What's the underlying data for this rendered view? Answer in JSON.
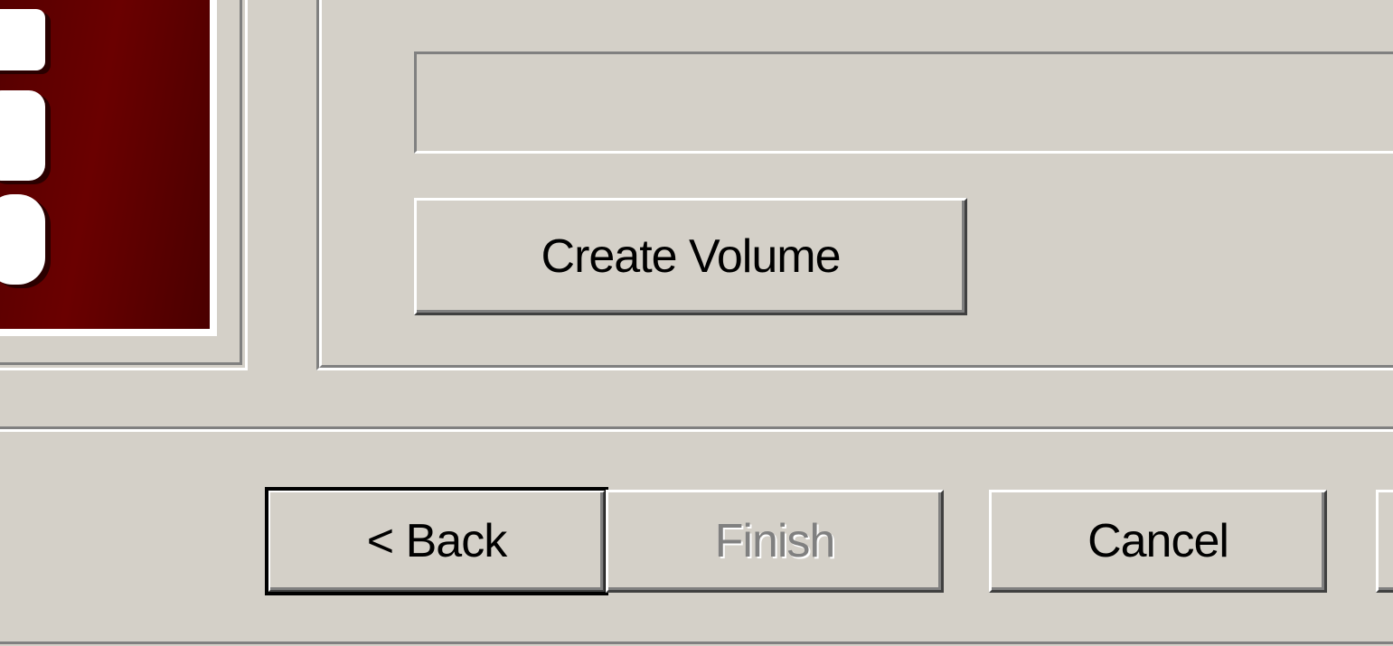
{
  "wizard": {
    "banner": {
      "image_name": "truecrypt-logo-banner"
    },
    "volume_location": {
      "value": "",
      "placeholder": ""
    },
    "create_volume_label": "Create Volume",
    "buttons": {
      "back": "< Back",
      "finish": "Finish",
      "cancel": "Cancel"
    }
  },
  "colors": {
    "face": "#d4d0c8",
    "banner": "#560000",
    "shadow": "#808080",
    "highlight": "#ffffff"
  }
}
